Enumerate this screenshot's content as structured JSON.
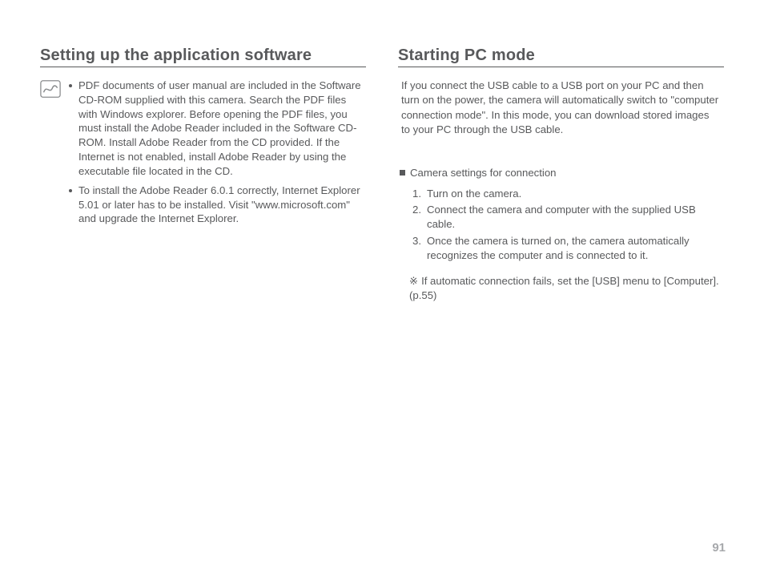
{
  "left": {
    "heading": "Setting up the application software",
    "bullets": [
      "PDF documents of user manual are included in the Software CD-ROM supplied with this camera. Search the PDF files with Windows explorer. Before opening the PDF files, you must install the Adobe Reader included in the Software CD-ROM. Install Adobe Reader from the CD provided. If the Internet is not enabled, install Adobe Reader by using the executable file located in the CD.",
      "To install the Adobe Reader 6.0.1 correctly, Internet Explorer 5.01 or later has to be installed. Visit \"www.microsoft.com\" and upgrade the Internet Explorer."
    ]
  },
  "right": {
    "heading": "Starting PC mode",
    "intro": "If you connect the USB cable to a USB port on your PC and then turn on the power, the camera will automatically switch to \"computer connection mode\". In this mode, you can download stored images to your PC through the USB cable.",
    "subheading": "Camera settings for connection",
    "steps": [
      "Turn on the camera.",
      "Connect the camera and computer with the supplied USB cable.",
      "Once the camera is turned on, the camera automatically recognizes the computer and is connected to it."
    ],
    "footnote_mark": "※",
    "footnote": "If automatic connection fails, set the [USB] menu to [Computer]. (p.55)"
  },
  "page_number": "91"
}
